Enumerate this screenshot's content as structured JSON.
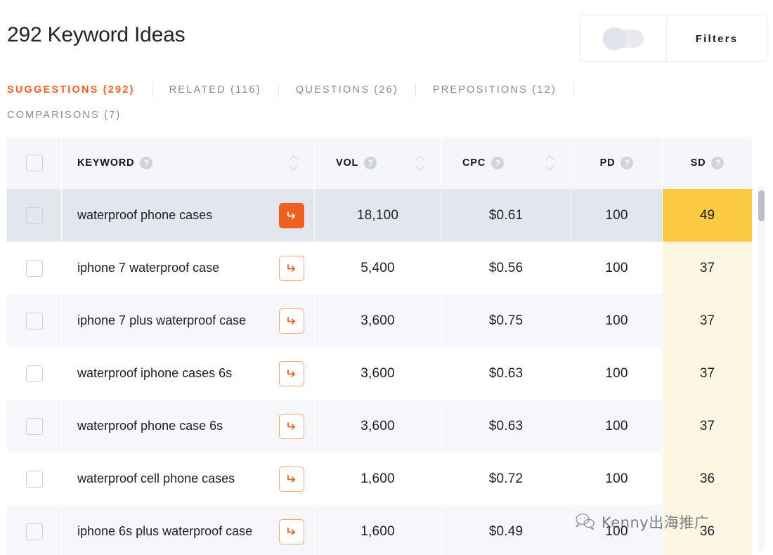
{
  "header": {
    "title": "292 Keyword Ideas",
    "filters_label": "Filters",
    "toggle_state": "off",
    "accent_color": "#ef6024"
  },
  "tabs": [
    {
      "label": "SUGGESTIONS (292)",
      "active": true
    },
    {
      "label": "RELATED (116)",
      "active": false
    },
    {
      "label": "QUESTIONS (26)",
      "active": false
    },
    {
      "label": "PREPOSITIONS (12)",
      "active": false
    },
    {
      "label": "COMPARISONS (7)",
      "active": false
    }
  ],
  "table": {
    "columns": [
      {
        "key": "keyword",
        "label": "KEYWORD",
        "help": "?",
        "sortable": true
      },
      {
        "key": "vol",
        "label": "VOL",
        "help": "?",
        "sortable": true
      },
      {
        "key": "cpc",
        "label": "CPC",
        "help": "?",
        "sortable": true
      },
      {
        "key": "pd",
        "label": "PD",
        "help": "?",
        "sortable": false
      },
      {
        "key": "sd",
        "label": "SD",
        "help": "?",
        "sortable": false
      }
    ],
    "rows": [
      {
        "keyword": "waterproof phone cases",
        "vol": "18,100",
        "cpc": "$0.61",
        "pd": "100",
        "sd": "49",
        "selected": true
      },
      {
        "keyword": "iphone 7 waterproof case",
        "vol": "5,400",
        "cpc": "$0.56",
        "pd": "100",
        "sd": "37",
        "selected": false
      },
      {
        "keyword": "iphone 7 plus waterproof case",
        "vol": "3,600",
        "cpc": "$0.75",
        "pd": "100",
        "sd": "37",
        "selected": false
      },
      {
        "keyword": "waterproof iphone cases 6s",
        "vol": "3,600",
        "cpc": "$0.63",
        "pd": "100",
        "sd": "37",
        "selected": false
      },
      {
        "keyword": "waterproof phone case 6s",
        "vol": "3,600",
        "cpc": "$0.63",
        "pd": "100",
        "sd": "37",
        "selected": false
      },
      {
        "keyword": "waterproof cell phone cases",
        "vol": "1,600",
        "cpc": "$0.72",
        "pd": "100",
        "sd": "36",
        "selected": false
      },
      {
        "keyword": "iphone 6s plus waterproof case",
        "vol": "1,600",
        "cpc": "$0.49",
        "pd": "100",
        "sd": "36",
        "selected": false
      }
    ],
    "sd_highlight_color": "#fbc944",
    "sd_column_color": "#fdf6e3"
  },
  "watermark": {
    "text": "Kenny出海推广"
  }
}
